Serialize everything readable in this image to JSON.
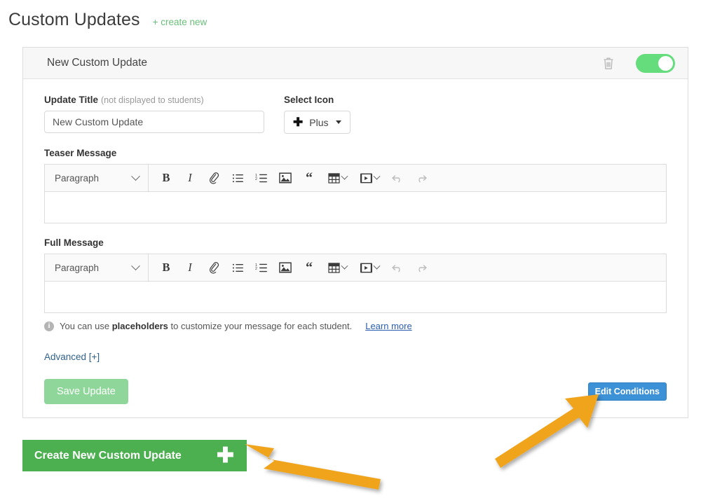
{
  "header": {
    "title": "Custom Updates",
    "create_new_link": "+ create new"
  },
  "card": {
    "head_title": "New Custom Update",
    "delete_icon": "trash-icon",
    "enabled_toggle": {
      "state": "on",
      "color": "#66dd7d"
    }
  },
  "form": {
    "update_title": {
      "label": "Update Title",
      "label_note": "(not displayed to students)",
      "value": "New Custom Update",
      "placeholder": "New Custom Update"
    },
    "select_icon": {
      "label": "Select Icon",
      "selected": "Plus",
      "glyph": "plus-icon"
    },
    "teaser": {
      "label": "Teaser Message",
      "content": ""
    },
    "full": {
      "label": "Full Message",
      "content": ""
    }
  },
  "editor_toolbar": {
    "block_format": "Paragraph",
    "tools": [
      {
        "name": "bold-icon",
        "glyph": "B"
      },
      {
        "name": "italic-icon",
        "glyph": "I"
      },
      {
        "name": "link-icon",
        "glyph": "link"
      },
      {
        "name": "bulleted-list-icon",
        "glyph": "list"
      },
      {
        "name": "numbered-list-icon",
        "glyph": "list-ol"
      },
      {
        "name": "image-icon",
        "glyph": "image"
      },
      {
        "name": "blockquote-icon",
        "glyph": "“"
      },
      {
        "name": "table-icon",
        "glyph": "table"
      },
      {
        "name": "video-icon",
        "glyph": "video"
      },
      {
        "name": "undo-icon",
        "glyph": "undo"
      },
      {
        "name": "redo-icon",
        "glyph": "redo"
      }
    ]
  },
  "hint": {
    "icon": "info-icon",
    "text_before": "You can use ",
    "bold_term": "placeholders",
    "text_after": " to customize your message for each student.",
    "learn_more": "Learn more"
  },
  "links": {
    "advanced": "Advanced [+]"
  },
  "buttons": {
    "save_update": "Save Update",
    "edit_conditions": "Edit Conditions",
    "create_new_custom_update": "Create New Custom Update"
  },
  "annotations": {
    "arrow_color": "#f0a41e",
    "arrow_to_create_button": "points left at Create New Custom Update plus",
    "arrow_to_edit_conditions": "points up-right at Edit Conditions button"
  },
  "colors": {
    "brand_green": "#4caf50",
    "toggle_green": "#66dd7d",
    "save_green": "#8fd69a",
    "link_blue": "#31628c",
    "button_blue": "#3d91d6",
    "annotation_orange": "#f0a41e"
  }
}
